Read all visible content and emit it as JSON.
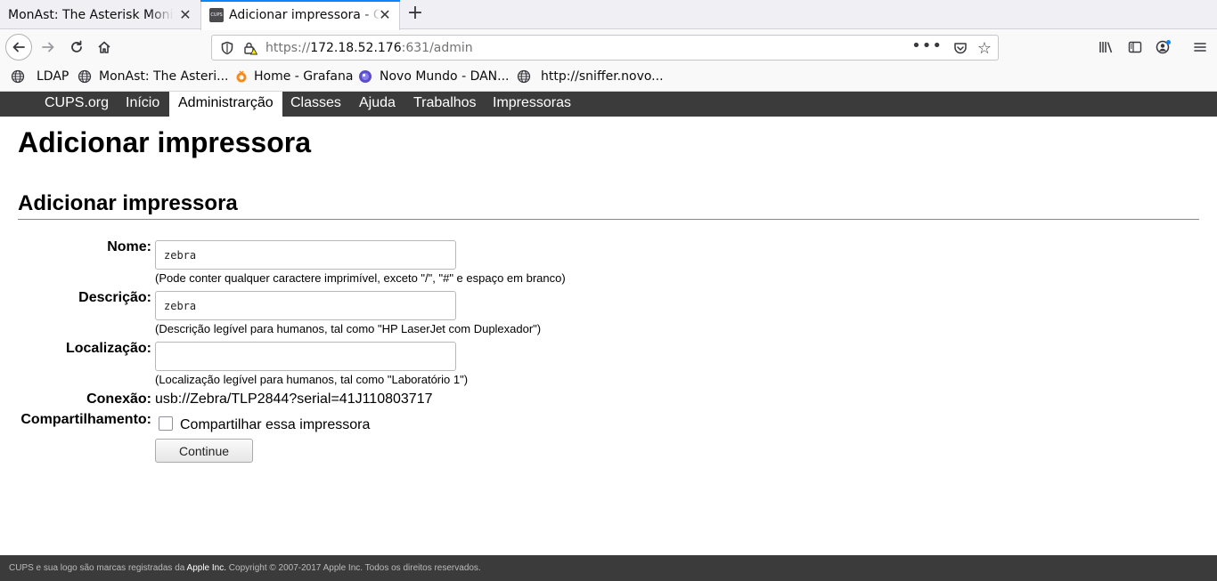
{
  "browser": {
    "tabs": [
      {
        "title": "MonAst: The Asterisk Monitor",
        "active": false
      },
      {
        "title": "Adicionar impressora - CUPS",
        "active": true
      }
    ],
    "url": {
      "scheme": "https://",
      "host": "172.18.52.176",
      "rest": ":631/admin"
    },
    "bookmarks": [
      {
        "label": "LDAP",
        "icon": "globe-icon"
      },
      {
        "label": "MonAst: The Asteri...",
        "icon": "globe-icon"
      },
      {
        "label": "Home - Grafana",
        "icon": "grafana-icon"
      },
      {
        "label": "Novo Mundo - DAN...",
        "icon": "novomundo-icon"
      },
      {
        "label": "http://sniffer.novo...",
        "icon": "globe-icon"
      }
    ]
  },
  "cups_nav": {
    "items": [
      {
        "label": "CUPS.org",
        "selected": false
      },
      {
        "label": "Início",
        "selected": false
      },
      {
        "label": "Administrarção",
        "selected": true
      },
      {
        "label": "Classes",
        "selected": false
      },
      {
        "label": "Ajuda",
        "selected": false
      },
      {
        "label": "Trabalhos",
        "selected": false
      },
      {
        "label": "Impressoras",
        "selected": false
      }
    ]
  },
  "page": {
    "title": "Adicionar impressora",
    "section_title": "Adicionar impressora"
  },
  "form": {
    "name": {
      "label": "Nome:",
      "value": "zebra",
      "hint": "(Pode conter qualquer caractere imprimível, exceto \"/\", \"#\" e espaço em branco)"
    },
    "description": {
      "label": "Descrição:",
      "value": "zebra",
      "hint": "(Descrição legível para humanos, tal como \"HP LaserJet com Duplexador\")"
    },
    "location": {
      "label": "Localização:",
      "value": "",
      "hint": "(Localização legível para humanos, tal como \"Laboratório 1\")"
    },
    "connection": {
      "label": "Conexão:",
      "value": "usb://Zebra/TLP2844?serial=41J110803717"
    },
    "sharing": {
      "label": "Compartilhamento:",
      "checkbox_label": "Compartilhar essa impressora",
      "checked": false
    },
    "submit_label": "Continue"
  },
  "footer": {
    "text_before": "CUPS e sua logo são marcas registradas da ",
    "brand": "Apple Inc.",
    "text_after": " Copyright © 2007-2017 Apple Inc. Todos os direitos reservados."
  },
  "colors": {
    "cups_nav_bg": "#3b3b3b",
    "firefox_accent": "#0a84ff"
  }
}
